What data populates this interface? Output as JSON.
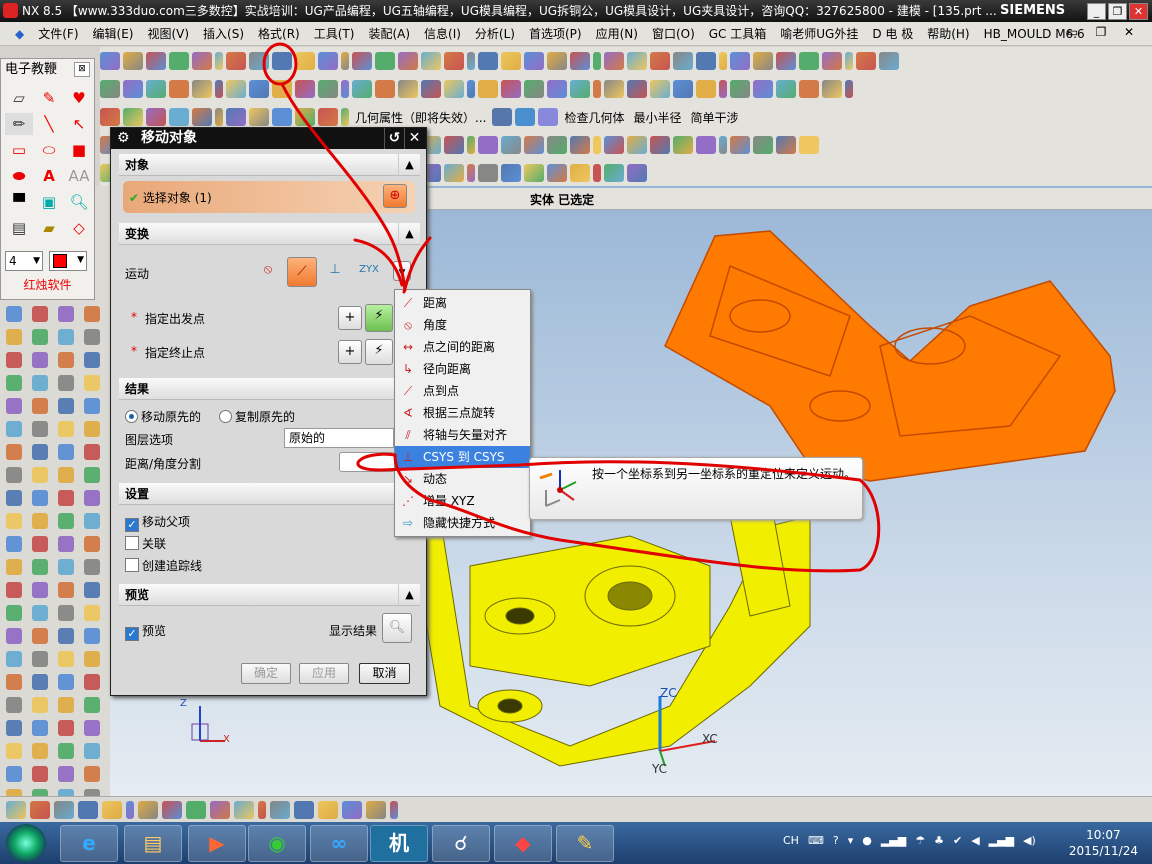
{
  "window": {
    "title": "NX 8.5 【www.333duo.com三多数控】实战培训：UG产品编程，UG五轴编程，UG模具编程，UG拆铜公，UG模具设计，UG夹具设计，咨询QQ：327625800 - 建模 - [135.prt ...",
    "brand": "SIEMENS"
  },
  "menu": [
    "文件(F)",
    "编辑(E)",
    "视图(V)",
    "插入(S)",
    "格式(R)",
    "工具(T)",
    "装配(A)",
    "信息(I)",
    "分析(L)",
    "首选项(P)",
    "应用(N)",
    "窗口(O)",
    "GC 工具箱",
    "喻老师UG外挂",
    "D 电  极",
    "帮助(H)",
    "HB_MOULD M6.6"
  ],
  "toolbar3": {
    "geom_props": "几何属性（即将失效）...",
    "check_geom": "检查几何体",
    "min_radius": "最小半径",
    "simple_interference": "简单干涉"
  },
  "viewport": {
    "status": "实体 已选定",
    "axes": {
      "zc": "ZC",
      "xc": "XC",
      "yc": "YC",
      "z": "Z",
      "x": "X"
    }
  },
  "palette": {
    "title": "电子教鞭",
    "close": "⊠",
    "size_value": "4",
    "footer": "红烛软件",
    "brush_color": "#ff0000"
  },
  "dialog": {
    "title": "移动对象",
    "sections": {
      "object": "对象",
      "transform": "变换",
      "result": "结果",
      "settings": "设置",
      "preview": "预览"
    },
    "select_object": "选择对象 (1)",
    "motion_label": "运动",
    "from_point": "指定出发点",
    "to_point": "指定终止点",
    "required_mark": "*",
    "move_original": "移动原先的",
    "copy_original": "复制原先的",
    "layer_option": "图层选项",
    "layer_value": "原始的",
    "distance_angle_divisions": "距离/角度分割",
    "move_parents": "移动父项",
    "associative": "关联",
    "create_trace": "创建追踪线",
    "preview_check": "预览",
    "show_result": "显示结果",
    "ok": "确定",
    "apply": "应用",
    "cancel": "取消",
    "checks": {
      "move_parents": true,
      "associative": false,
      "create_trace": false,
      "preview": true
    }
  },
  "motion_menu": [
    {
      "label": "距离",
      "icon": "distance-icon"
    },
    {
      "label": "角度",
      "icon": "angle-icon"
    },
    {
      "label": "点之间的距离",
      "icon": "distance-between-points-icon"
    },
    {
      "label": "径向距离",
      "icon": "radial-distance-icon"
    },
    {
      "label": "点到点",
      "icon": "point-to-point-icon"
    },
    {
      "label": "根据三点旋转",
      "icon": "rotate-three-points-icon"
    },
    {
      "label": "将轴与矢量对齐",
      "icon": "align-axis-vector-icon"
    },
    {
      "label": "CSYS 到 CSYS",
      "icon": "csys-to-csys-icon",
      "highlighted": true
    },
    {
      "label": "动态",
      "icon": "dynamic-icon"
    },
    {
      "label": "增量 XYZ",
      "icon": "delta-xyz-icon"
    },
    {
      "label": "隐藏快捷方式",
      "icon": "hide-shortcuts-icon"
    }
  ],
  "tooltip": "按一个坐标系到另一坐标系的重定位来定义运动。",
  "taskbar": {
    "tray_lang": "CH",
    "time": "10:07",
    "date": "2015/11/24",
    "app_ji": "机"
  },
  "colors": {
    "selected_part": "#ff7a00",
    "part": "#f2ee00",
    "annotation": "#e00000",
    "menu_highlight": "#3b82e0"
  }
}
